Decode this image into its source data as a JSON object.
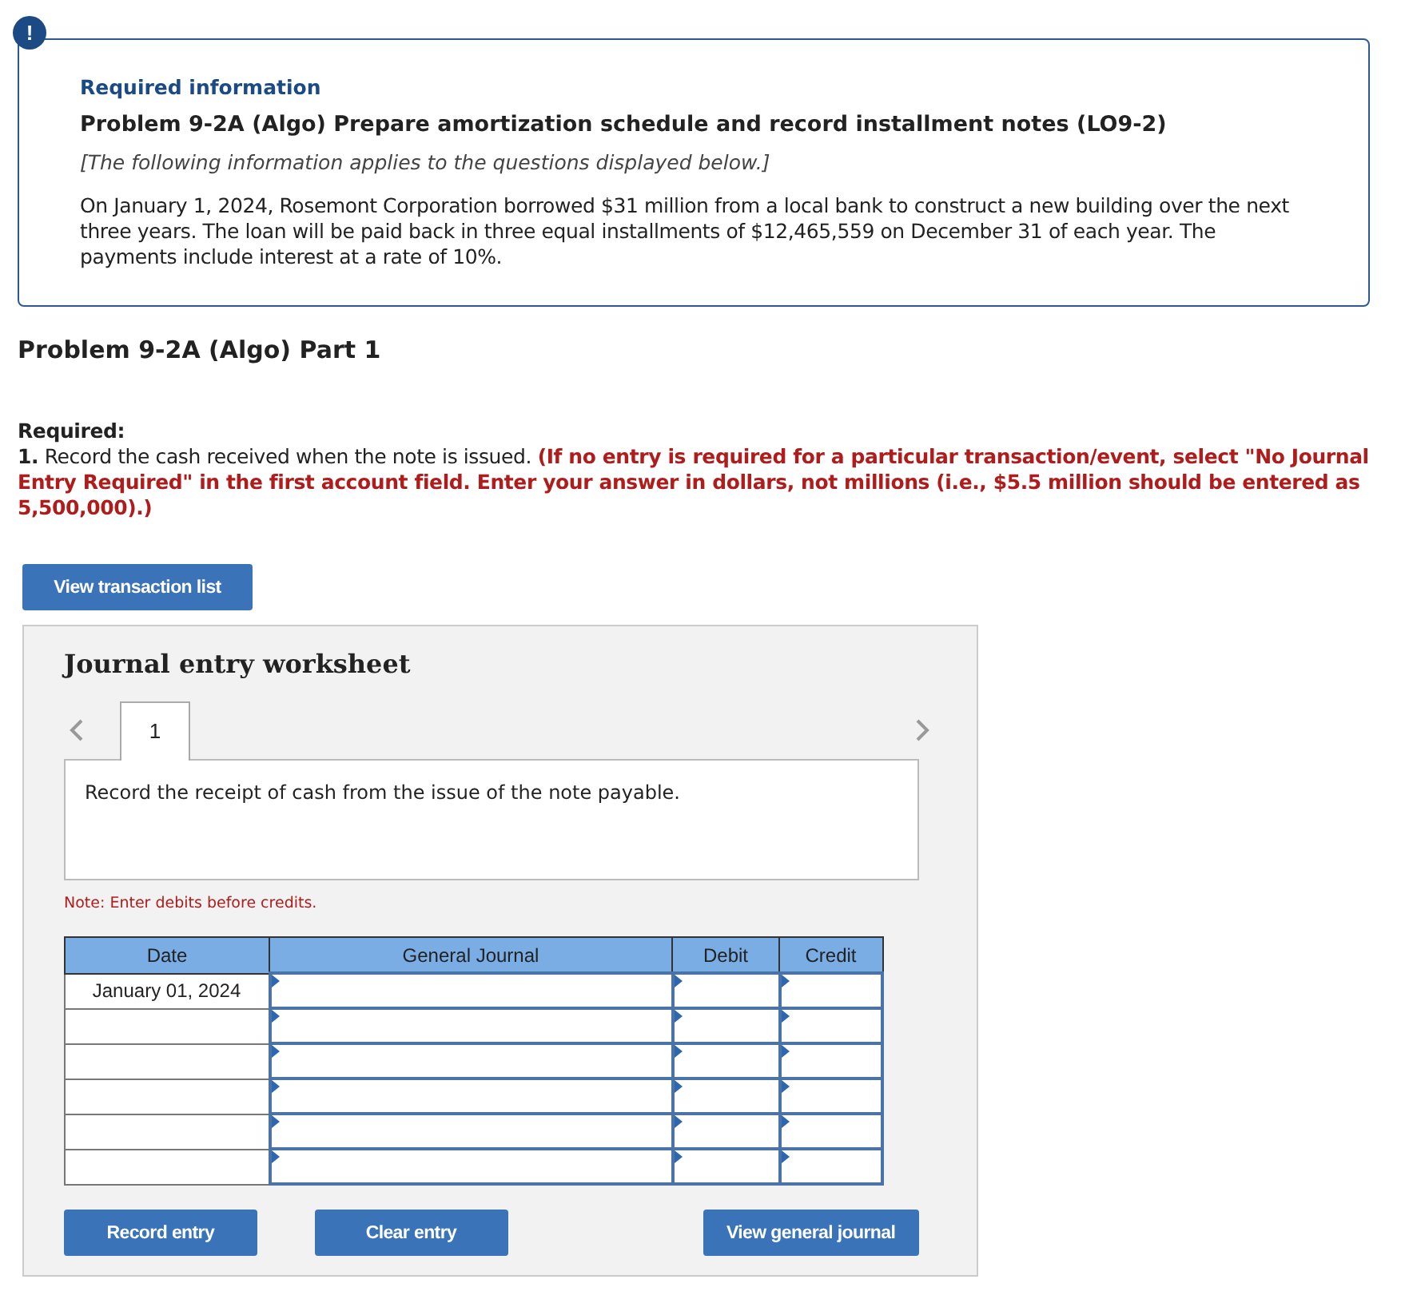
{
  "info": {
    "icon": "!",
    "heading": "Required information",
    "problem_title": "Problem 9-2A (Algo) Prepare amortization schedule and record installment notes (LO9-2)",
    "note": "[The following information applies to the questions displayed below.]",
    "body": "On January 1, 2024, Rosemont Corporation borrowed $31 million from a local bank to construct a new building over the next three years. The loan will be paid back in three equal installments of $12,465,559 on December 31 of each year. The payments include interest at a rate of 10%."
  },
  "part_title": "Problem 9-2A (Algo) Part 1",
  "required": {
    "label": "Required:",
    "number": "1.",
    "text": "Record the cash received when the note is issued.",
    "instruction": "(If no entry is required for a particular transaction/event, select \"No Journal Entry Required\" in the first account field. Enter your answer in dollars, not millions (i.e., $5.5 million should be entered as 5,500,000).)"
  },
  "view_transactions_button": "View transaction list",
  "worksheet": {
    "title": "Journal entry worksheet",
    "tabs": [
      {
        "label": "1",
        "selected": true
      }
    ],
    "description": "Record the receipt of cash from the issue of the note payable.",
    "note": "Note: Enter debits before credits.",
    "columns": [
      "Date",
      "General Journal",
      "Debit",
      "Credit"
    ],
    "rows": [
      {
        "date": "January 01, 2024"
      },
      {},
      {},
      {},
      {},
      {}
    ],
    "buttons": [
      "Record entry",
      "Clear entry",
      "View general journal"
    ]
  }
}
